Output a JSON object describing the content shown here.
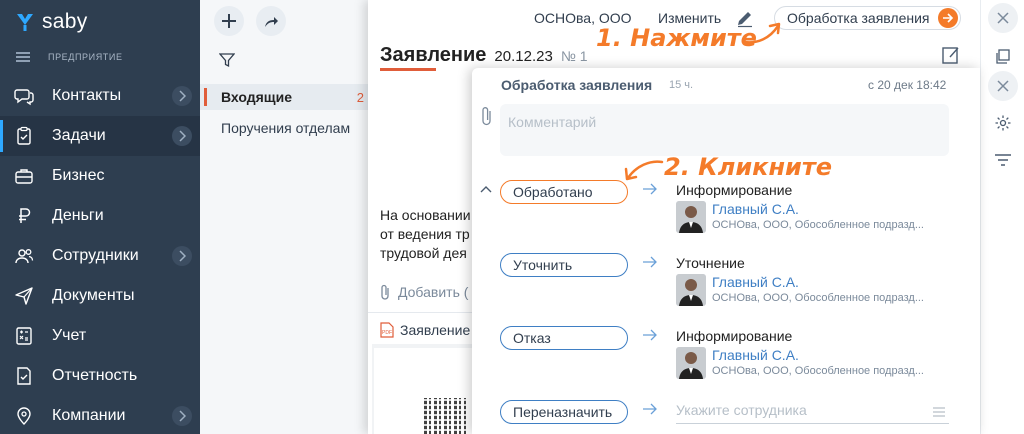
{
  "nav": {
    "brand": "saby",
    "section": "ПРЕДПРИЯТИЕ",
    "items": [
      {
        "label": "Контакты",
        "icon": "chat-bubbles-icon",
        "has_arrow": true,
        "active": false
      },
      {
        "label": "Задачи",
        "icon": "clipboard-check-icon",
        "has_arrow": true,
        "active": true
      },
      {
        "label": "Бизнес",
        "icon": "briefcase-icon",
        "has_arrow": false,
        "active": false
      },
      {
        "label": "Деньги",
        "icon": "ruble-icon",
        "has_arrow": false,
        "active": false
      },
      {
        "label": "Сотрудники",
        "icon": "people-icon",
        "has_arrow": true,
        "active": false
      },
      {
        "label": "Документы",
        "icon": "paper-plane-icon",
        "has_arrow": false,
        "active": false
      },
      {
        "label": "Учет",
        "icon": "calculator-icon",
        "has_arrow": false,
        "active": false
      },
      {
        "label": "Отчетность",
        "icon": "report-shield-icon",
        "has_arrow": false,
        "active": false
      },
      {
        "label": "Компании",
        "icon": "map-pin-icon",
        "has_arrow": true,
        "active": false
      }
    ]
  },
  "list": {
    "rows": [
      {
        "label": "Входящие",
        "count": "2",
        "selected": true
      },
      {
        "label": "Поручения отделам",
        "count": "",
        "selected": false
      }
    ]
  },
  "document": {
    "org": "ОСНОва, ООО",
    "edit_label": "Изменить",
    "process_button": "Обработка заявления",
    "title": "Заявление",
    "date": "20.12.23",
    "number": "№ 1",
    "body_lines": [
      "На основании",
      "от ведения тр",
      "трудовой дея"
    ],
    "attach_label": "Добавить (",
    "file_label": "Заявление"
  },
  "popup": {
    "title": "Обработка заявления",
    "age": "15 ч.",
    "date": "с 20 дек 18:42",
    "comment_placeholder": "Комментарий",
    "actions": [
      {
        "button": "Обработано",
        "target_type": "Информирование",
        "person": "Главный С.А.",
        "org": "ОСНОва, ООО, Обособленное подразд...",
        "primary": true
      },
      {
        "button": "Уточнить",
        "target_type": "Уточнение",
        "person": "Главный С.А.",
        "org": "ОСНОва, ООО, Обособленное подразд...",
        "primary": false
      },
      {
        "button": "Отказ",
        "target_type": "Информирование",
        "person": "Главный С.А.",
        "org": "ОСНОва, ООО, Обособленное подразд...",
        "primary": false
      }
    ],
    "reassign": {
      "button": "Переназначить",
      "placeholder": "Укажите сотрудника"
    }
  },
  "annotations": {
    "step1": "1. Нажмите",
    "step2": "2. Кликните"
  },
  "colors": {
    "nav_bg": "#2e3e50",
    "accent_orange": "#f47b2a",
    "link_blue": "#3f7fc4",
    "active_marker": "#2ea8ff"
  }
}
